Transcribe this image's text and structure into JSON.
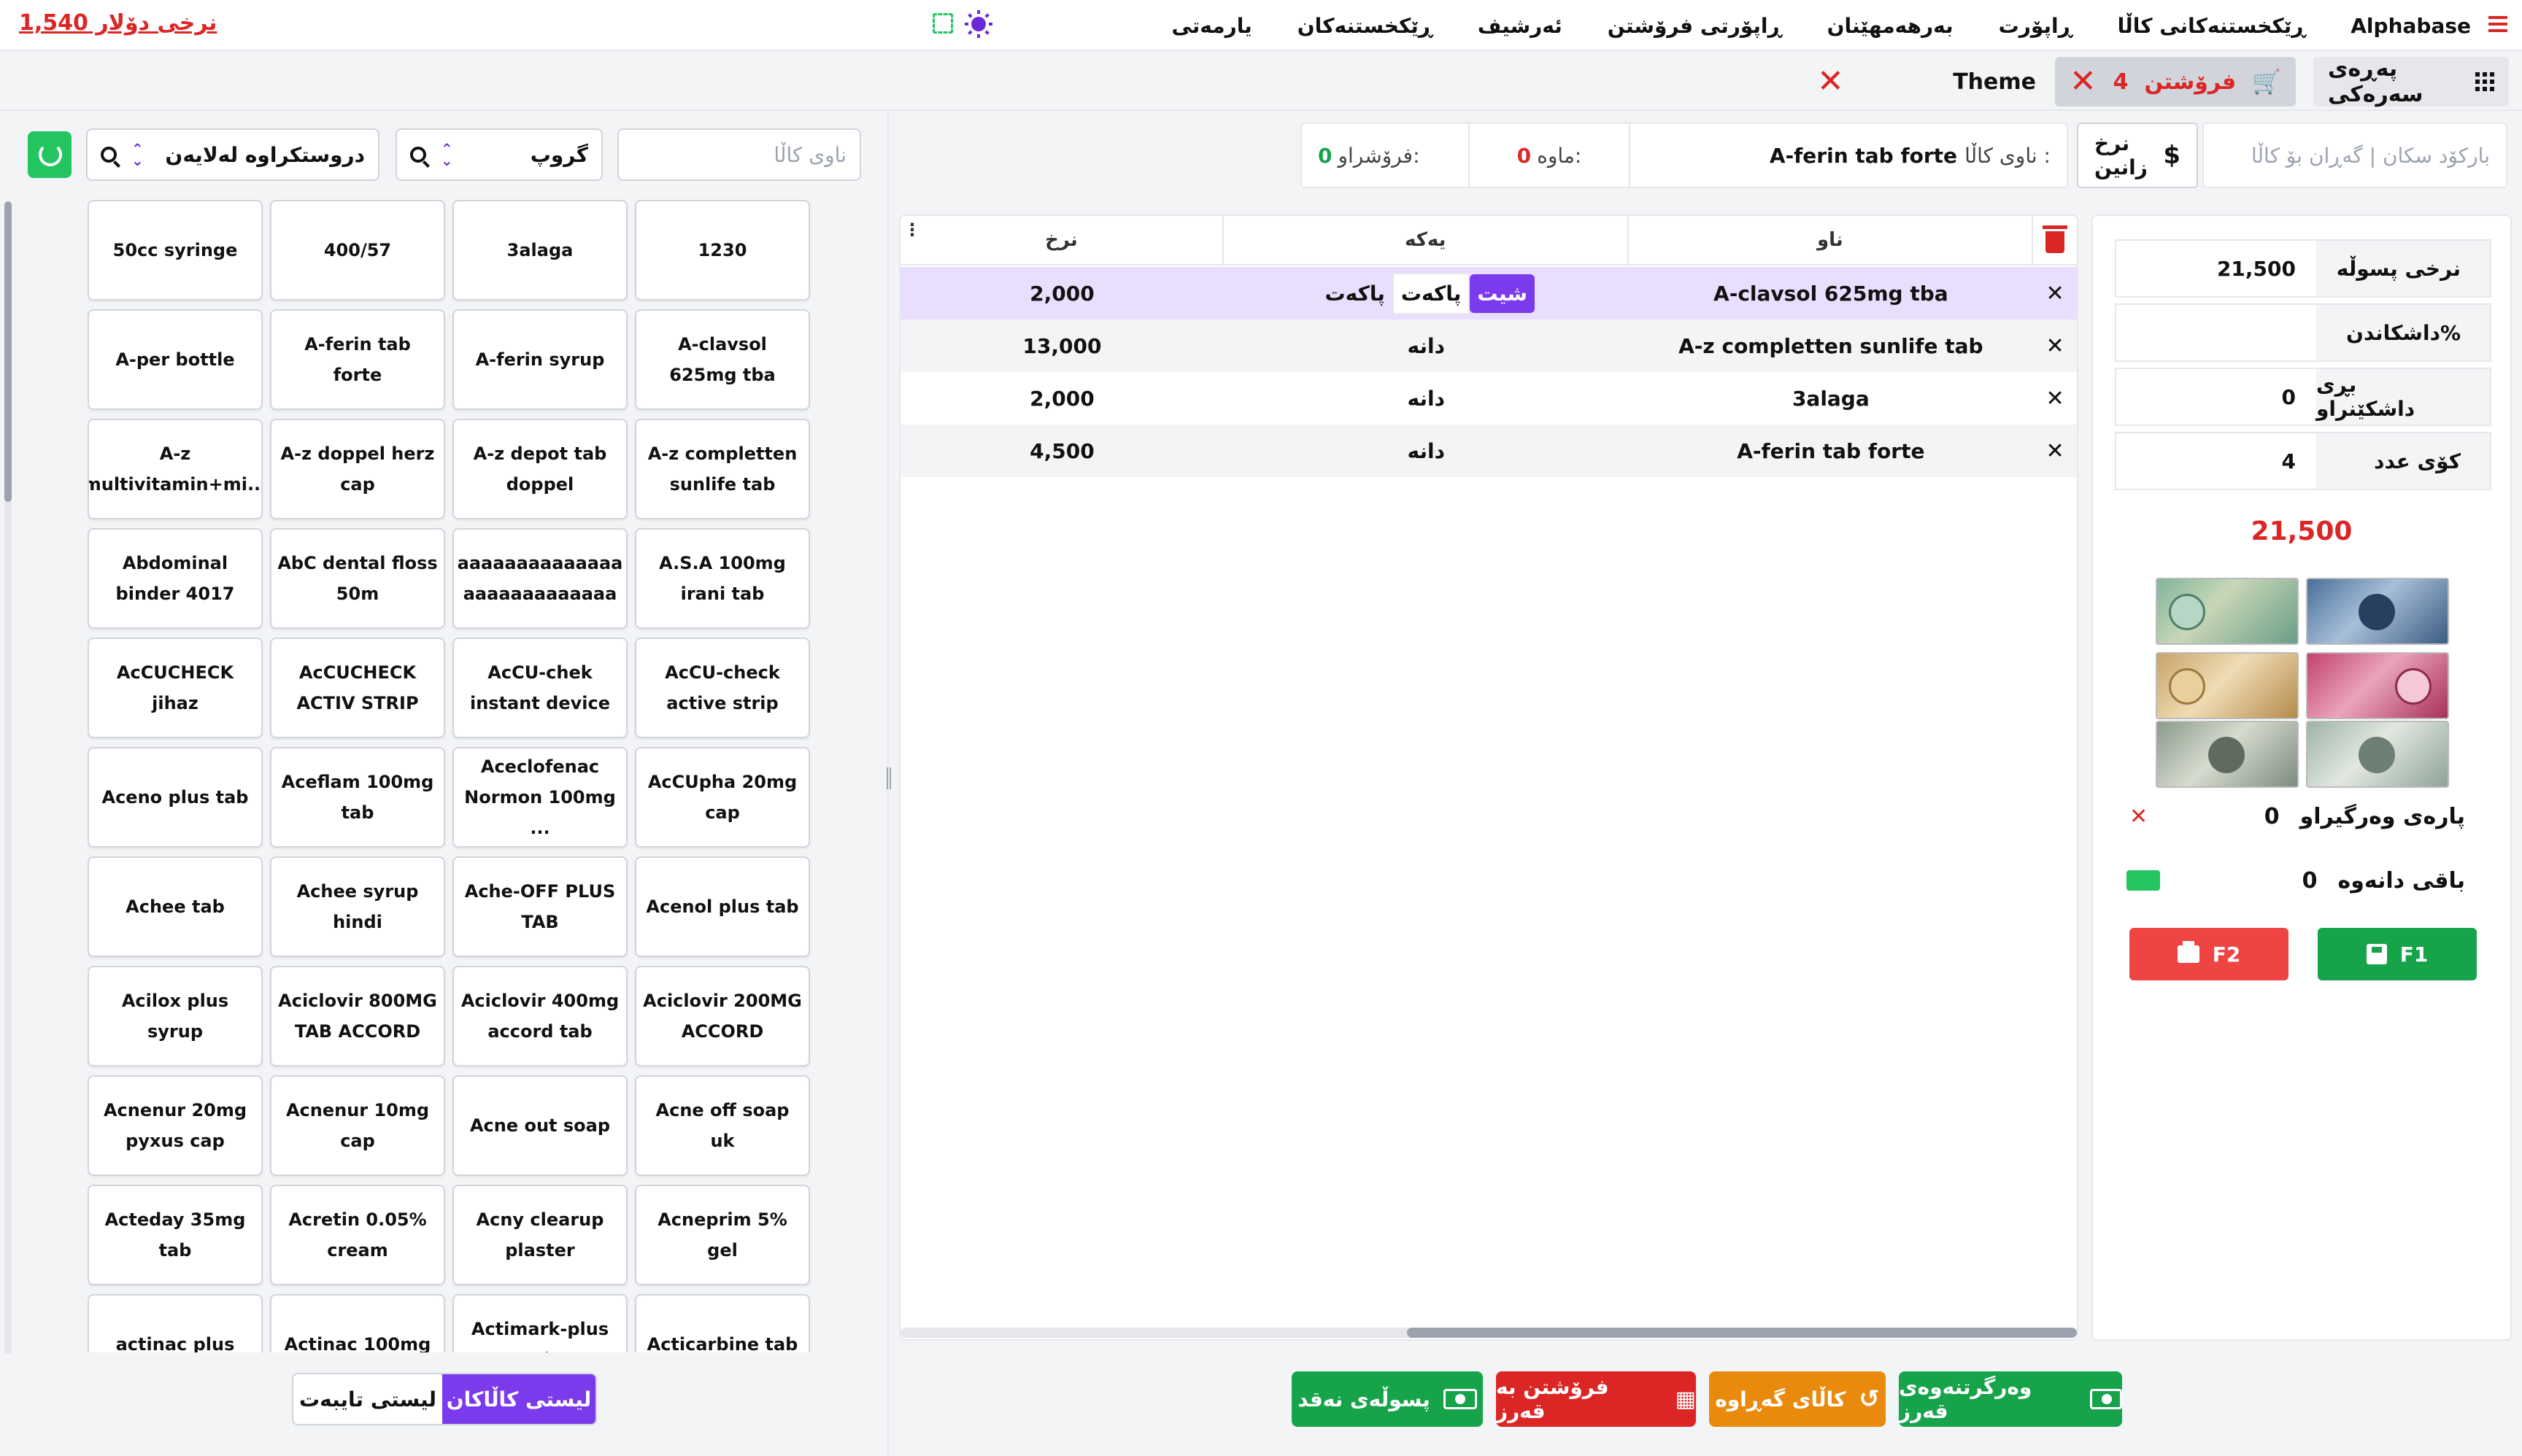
{
  "topbar": {
    "dollar_rate": "نرخی دۆلار 1,540",
    "icons": [
      "fullscreen-icon",
      "sun-icon",
      "hamburger-icon"
    ],
    "nav": [
      "Alphabase",
      "ڕێکخستنەکانی کاڵا",
      "ڕاپۆرت",
      "بەرهەمهێنان",
      "ڕاپۆرتی فرۆشتن",
      "ئەرشیف",
      "ڕێکخستنەکان",
      "یارمەتی"
    ]
  },
  "tabs": {
    "home": "پەڕەی سەرەکی",
    "sale_label": "فرۆشتن",
    "sale_count": "4",
    "theme": "Theme"
  },
  "filters": {
    "product_name_placeholder": "ناوی کاڵا",
    "group": "گروپ",
    "company": "دروستکراوە لەلایەن"
  },
  "products": [
    "1230",
    "3alaga",
    "400/57",
    "50cc syringe",
    "A-clavsol 625mg tba",
    "A-ferin syrup",
    "A-ferin tab forte",
    "A-per bottle",
    "A-z completten sunlife tab",
    "A-z depot tab doppel",
    "A-z doppel herz cap",
    "A-z multivitamin+mi...",
    "A.S.A 100mg irani tab",
    "aaaaaaaaaaaaaa aaaaaaaaaaaaa",
    "AbC dental floss 50m",
    "Abdominal binder 4017",
    "AcCU-check active strip",
    "AcCU-chek instant device",
    "AcCUCHECK ACTIV STRIP",
    "AcCUCHECK jihaz",
    "AcCUpha 20mg cap",
    "Aceclofenac Normon 100mg ...",
    "Aceflam 100mg tab",
    "Aceno plus tab",
    "Acenol plus tab",
    "Ache-OFF PLUS TAB",
    "Achee syrup hindi",
    "Achee tab",
    "Aciclovir 200MG ACCORD",
    "Aciclovir 400mg accord tab",
    "Aciclovir 800MG TAB ACCORD",
    "Acilox plus syrup",
    "Acne off soap uk",
    "Acne out soap",
    "Acnenur 10mg cap",
    "Acnenur 20mg pyxus cap",
    "Acneprim 5% gel",
    "Acny clearup plaster",
    "Acretin 0.05% cream",
    "Acteday 35mg tab",
    "Acticarbine tab",
    "Actimark-plus tab",
    "Actinac 100mg",
    "actinac plus"
  ],
  "list_toggle": {
    "special": "لیستی تایبەت",
    "items": "لیستی کاڵاکان"
  },
  "center_info": {
    "barcode_placeholder": "بارکۆد سکان | گەڕان بۆ کاڵا",
    "price_check": "نرخ زانین",
    "product_label": "ناوی کاڵا :",
    "product_value": "A-ferin tab forte",
    "remaining_label": "ماوە:",
    "remaining_value": "0",
    "sold_label": "فرۆشراو:",
    "sold_value": "0"
  },
  "cart": {
    "headers": {
      "name": "ناو",
      "unit": "یەکە",
      "price": "نرخ"
    },
    "rows": [
      {
        "name": "A-clavsol 625mg tba",
        "units": [
          "شیت",
          "پاکەت",
          "پاکەت"
        ],
        "active_unit": "شیت",
        "price": "2,000",
        "selected": true
      },
      {
        "name": "A-z completten sunlife tab",
        "unit": "دانە",
        "price": "13,000"
      },
      {
        "name": "3alaga",
        "unit": "دانە",
        "price": "2,000"
      },
      {
        "name": "A-ferin tab forte",
        "unit": "دانە",
        "price": "4,500"
      }
    ]
  },
  "actions": {
    "debt_collect": "وەرگرتنەوەی قەرز",
    "return": "کاڵای گەڕاوە",
    "credit_sale": "فرۆشتن بە قەرز",
    "cash_receipt": "پسوڵەی نەقد"
  },
  "summary": {
    "invoice_price_label": "نرخی پسوڵە",
    "invoice_price_value": "21,500",
    "discount_label": "داشکاندن%",
    "discount_value": "",
    "discount_amount_label": "بڕی داشکێنراو",
    "discount_amount_value": "0",
    "count_label": "کۆی عدد",
    "count_value": "4",
    "grand_total": "21,500",
    "received_label": "پارەی وەرگیراو",
    "received_value": "0",
    "change_label": "باقی دانەوە",
    "change_value": "0",
    "f1": "F1",
    "f2": "F2"
  },
  "colors": {
    "accent": "#7c3aed",
    "green": "#16a34a",
    "red": "#dc2626",
    "orange": "#ea8a0c"
  }
}
